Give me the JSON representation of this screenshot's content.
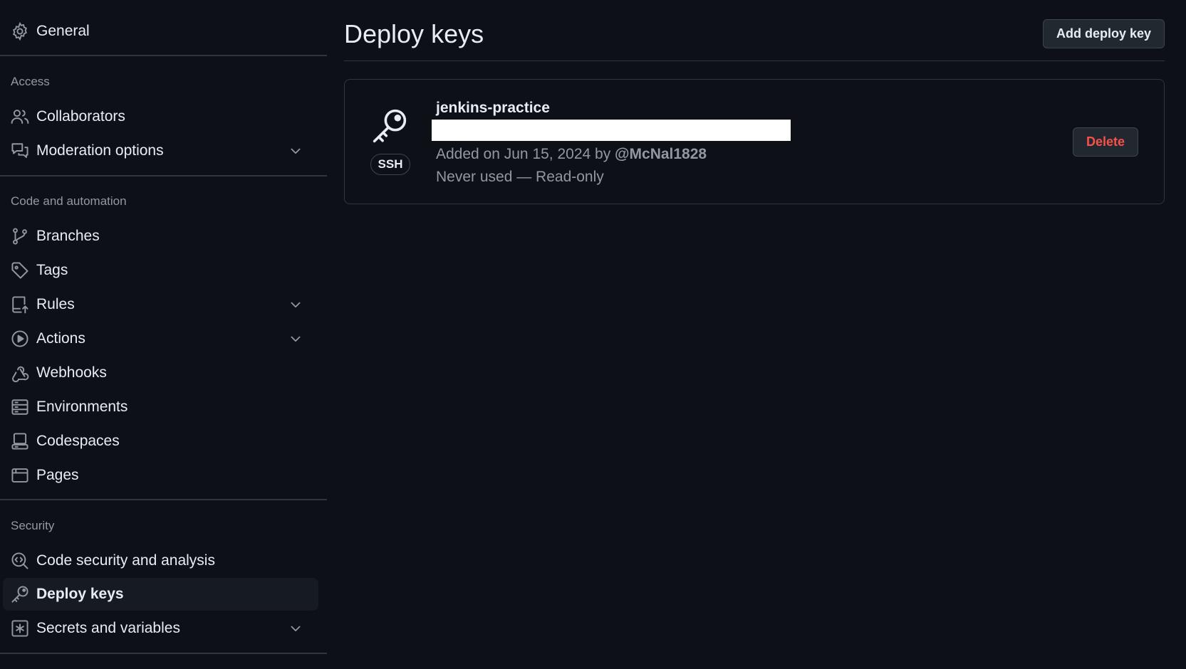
{
  "colors": {
    "background": "#0d1117",
    "text": "#e6edf3",
    "muted": "#9198a1",
    "border": "#30363d",
    "danger": "#f85149",
    "active_item_bg": "#161b22"
  },
  "sidebar": {
    "general": {
      "label": "General",
      "icon": "gear-icon"
    },
    "access": {
      "heading": "Access",
      "items": [
        {
          "label": "Collaborators",
          "icon": "people-icon",
          "expandable": false
        },
        {
          "label": "Moderation options",
          "icon": "comment-discussion-icon",
          "expandable": true
        }
      ]
    },
    "code_automation": {
      "heading": "Code and automation",
      "items": [
        {
          "label": "Branches",
          "icon": "git-branch-icon",
          "expandable": false
        },
        {
          "label": "Tags",
          "icon": "tag-icon",
          "expandable": false
        },
        {
          "label": "Rules",
          "icon": "repo-push-icon",
          "expandable": true
        },
        {
          "label": "Actions",
          "icon": "play-icon",
          "expandable": true
        },
        {
          "label": "Webhooks",
          "icon": "webhook-icon",
          "expandable": false
        },
        {
          "label": "Environments",
          "icon": "server-icon",
          "expandable": false
        },
        {
          "label": "Codespaces",
          "icon": "codespaces-icon",
          "expandable": false
        },
        {
          "label": "Pages",
          "icon": "browser-icon",
          "expandable": false
        }
      ]
    },
    "security": {
      "heading": "Security",
      "items": [
        {
          "label": "Code security and analysis",
          "icon": "codescan-icon",
          "expandable": false
        },
        {
          "label": "Deploy keys",
          "icon": "key-icon",
          "expandable": false,
          "active": true
        },
        {
          "label": "Secrets and variables",
          "icon": "key-asterisk-icon",
          "expandable": true
        }
      ]
    }
  },
  "main": {
    "title": "Deploy keys",
    "add_button_label": "Add deploy key",
    "keys": [
      {
        "title": "jenkins-practice",
        "type_badge": "SSH",
        "added_prefix": "Added on Jun 15, 2024 by ",
        "author": "@McNal1828",
        "usage": "Never used — Read-only",
        "delete_label": "Delete",
        "icon": "key-icon"
      }
    ]
  }
}
